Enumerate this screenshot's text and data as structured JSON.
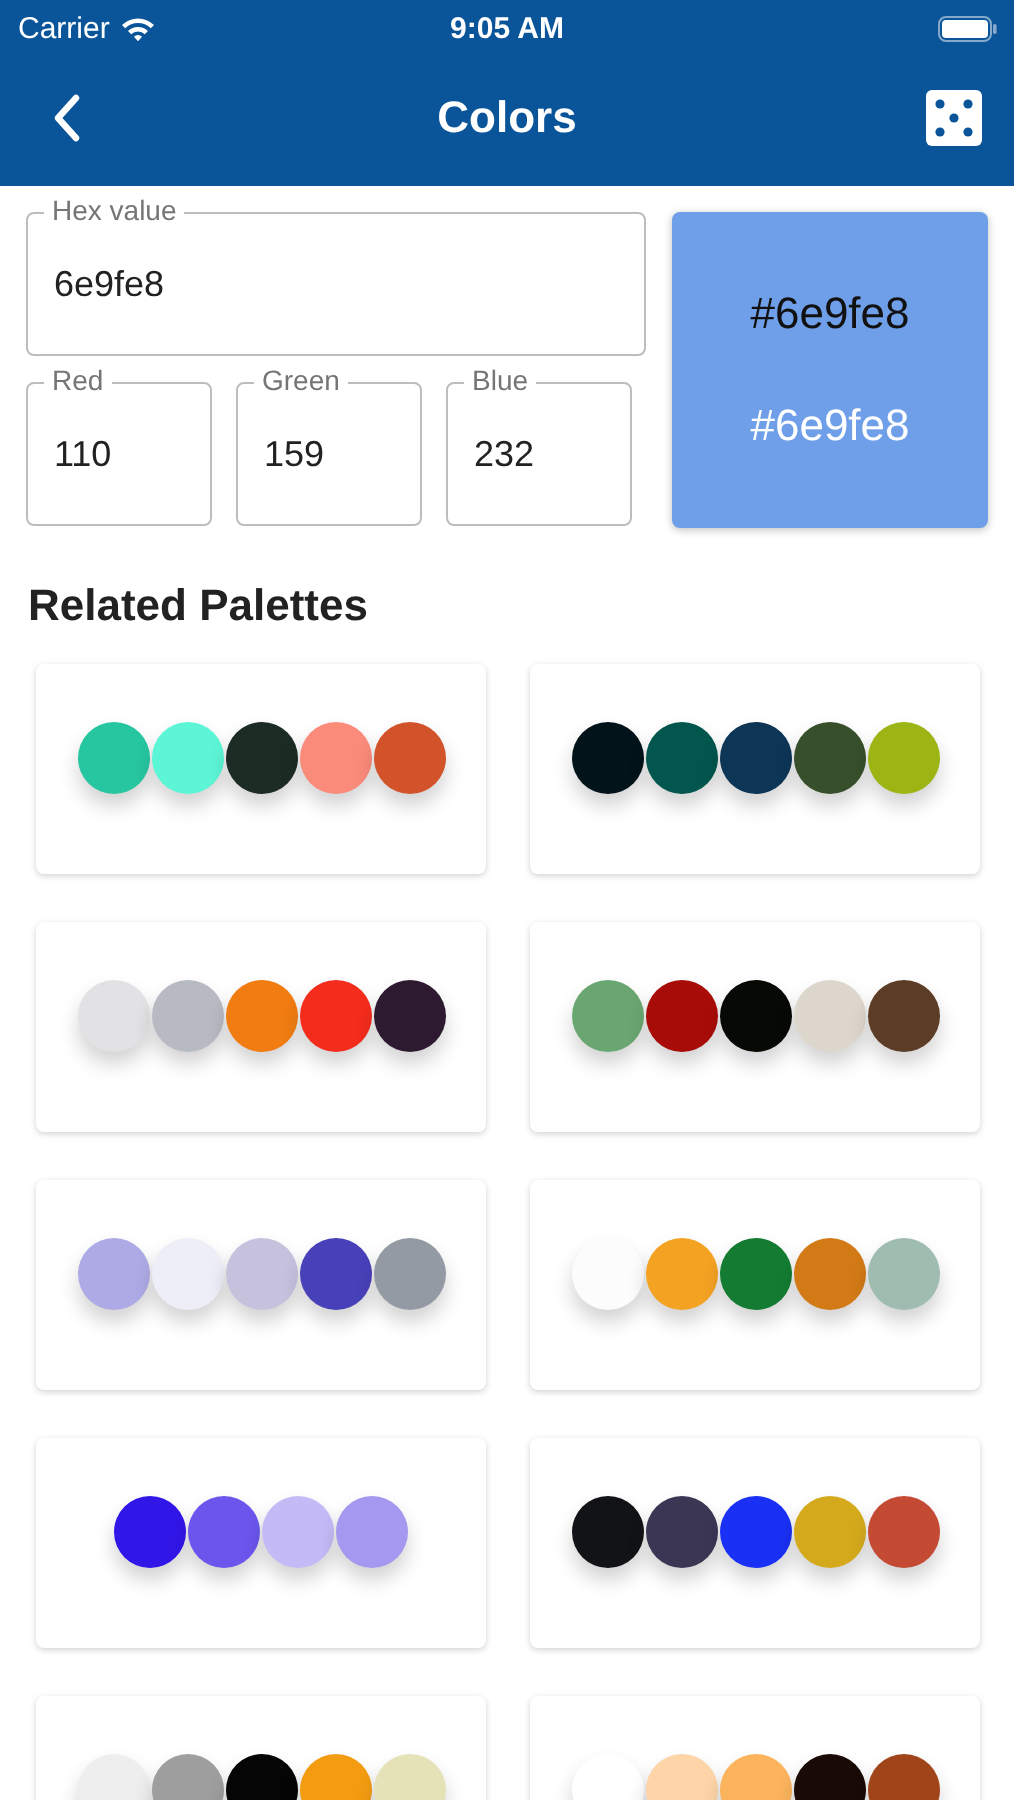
{
  "status_bar": {
    "carrier": "Carrier",
    "time": "9:05 AM"
  },
  "nav": {
    "title": "Colors"
  },
  "hex_field": {
    "label": "Hex value",
    "value": "6e9fe8"
  },
  "rgb_fields": [
    {
      "label": "Red",
      "value": "110"
    },
    {
      "label": "Green",
      "value": "159"
    },
    {
      "label": "Blue",
      "value": "232"
    }
  ],
  "preview": {
    "color": "#6e9fe8",
    "dark_text": "#6e9fe8",
    "light_text": "#6e9fe8"
  },
  "section_title": "Related Palettes",
  "palettes": [
    {
      "colors": [
        {
          "color": "#26c6a0"
        },
        {
          "color": "#5cf5d6"
        },
        {
          "color": "#1c2b24"
        },
        {
          "color": "#fa8a7a"
        },
        {
          "color": "#d2522a"
        }
      ]
    },
    {
      "colors": [
        {
          "color": "#03131a"
        },
        {
          "color": "#03564e"
        },
        {
          "color": "#0d3556"
        },
        {
          "color": "#374f2a"
        },
        {
          "color": "#9cb414"
        }
      ]
    },
    {
      "colors": [
        {
          "color": "#e2e2e4"
        },
        {
          "color": "#b8bac3"
        },
        {
          "color": "#f07c12"
        },
        {
          "color": "#f42c1c"
        },
        {
          "color": "#2e1a30"
        }
      ]
    },
    {
      "colors": [
        {
          "color": "#6aa670"
        },
        {
          "color": "#a80c08"
        },
        {
          "color": "#070905"
        },
        {
          "color": "#ddd6cc"
        },
        {
          "color": "#5c3c24"
        }
      ]
    },
    {
      "colors": [
        {
          "color": "#aeaae6"
        },
        {
          "color": "#eeeef8"
        },
        {
          "color": "#c6c2de"
        },
        {
          "color": "#4840b8"
        },
        {
          "color": "#949aa4"
        }
      ]
    },
    {
      "colors": [
        {
          "color": "#fcfcfc"
        },
        {
          "color": "#f4a222"
        },
        {
          "color": "#147c32"
        },
        {
          "color": "#d27a16"
        },
        {
          "color": "#9ebcb0"
        }
      ]
    },
    {
      "colors": [
        {
          "color": "#3116e8"
        },
        {
          "color": "#6a56ec"
        },
        {
          "color": "#c4baf6"
        },
        {
          "color": "#a498f0"
        }
      ]
    },
    {
      "colors": [
        {
          "color": "#121316"
        },
        {
          "color": "#3a3654"
        },
        {
          "color": "#1a30f4"
        },
        {
          "color": "#d4aa1c"
        },
        {
          "color": "#c44a34"
        }
      ]
    },
    {
      "colors": [
        {
          "color": "#eeeeee"
        },
        {
          "color": "#9e9e9e"
        },
        {
          "color": "#050505"
        },
        {
          "color": "#f39c12"
        },
        {
          "color": "#e6e2b8"
        }
      ]
    },
    {
      "colors": [
        {
          "color": "#ffffff"
        },
        {
          "color": "#fdd5a8"
        },
        {
          "color": "#fbb45c"
        },
        {
          "color": "#1a0a05"
        },
        {
          "color": "#a0451a"
        }
      ]
    }
  ]
}
